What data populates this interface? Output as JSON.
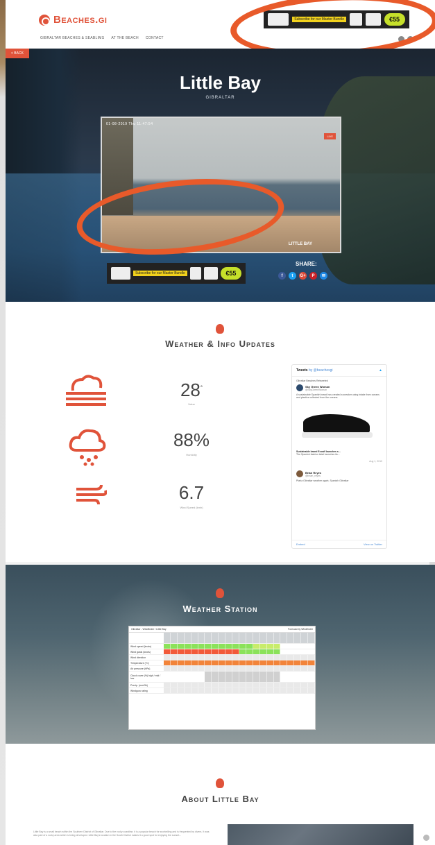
{
  "header": {
    "logo": "Beaches.gi",
    "nav": [
      "GIBRALTAR BEACHES & SEABLIMS",
      "AT THE BEACH",
      "CONTACT"
    ],
    "ad_top": {
      "green_badge": "€55",
      "yellow_text": "Subscribe for our Master Bundle"
    }
  },
  "hero": {
    "back_label": "< BACK",
    "title": "Little Bay",
    "subtitle": "GIBRALTAR",
    "webcam": {
      "timestamp": "01-08-2019  Thu  11:47:54",
      "live_badge": "LIVE",
      "camera_label": "LITTLE BAY"
    },
    "ad": {
      "green_badge": "€55",
      "yellow_text": "Subscribe for our Master Bundle"
    },
    "share_label": "SHARE:",
    "share_buttons": [
      "f",
      "t",
      "G+",
      "P",
      "✉"
    ]
  },
  "weather_info": {
    "title": "Weather & Info Updates",
    "stats": [
      {
        "value": "28",
        "unit": "°",
        "label": "Value"
      },
      {
        "value": "88%",
        "label": "Humidity"
      },
      {
        "value": "6.7",
        "label": "Wind Speed (kmh)"
      }
    ],
    "tweets": {
      "header": "Tweets",
      "header_by": "by @beachesgi",
      "retweet_note": "Gibraltar Beaches Retweeted",
      "author_name": "Sky Green Woman",
      "author_handle": "@SkyGreenWoman",
      "body": "A sustainable Spanish brand has created a sneaker using intake from oceans and plastics collected from the oceans.",
      "card_title": "Sustainable brand Ecoalf launches s...",
      "card_desc": "The Spanish fashion label launches its...",
      "date": "Aug 1, 2019",
      "second_author": "Brian Reyes",
      "second_handle": "@brian_reyes",
      "second_body": "Ptaha Gibraltar weather again. Spanish Gibraltar",
      "footer_left": "Embed",
      "footer_right": "View on Twitter"
    }
  },
  "station": {
    "title": "Weather Station",
    "forecast": {
      "header_left": "Gibraltar - Windfinder / Little Bay",
      "header_right": "Forecast by Windfinder",
      "row_labels": [
        "",
        "Wind speed (knots)",
        "Wind gusts (knots)",
        "Wind direction",
        "Temperature (°C)",
        "Air pressure (hPa)",
        "Cloud cover (%) high / mid / low",
        "Precip. (mm/3h)",
        "Windguru rating"
      ],
      "colors": [
        "#8be25a",
        "#f25a3a",
        "#f2b23a",
        "#e9e9e9",
        "#f2843a"
      ]
    }
  },
  "about": {
    "title": "About Little Bay",
    "text": "Little Bay is a small beach within the Southern District of Gibraltar. Due to the rocky coastline, it is a popular beach for snorkelling and is frequented by divers. It was also part of a rocky area which is being developed. Little Bay's location in the South District makes it a good spot for enjoying the sunset..."
  },
  "colors": {
    "accent": "#e0533a",
    "scribble": "#e85a2a"
  }
}
